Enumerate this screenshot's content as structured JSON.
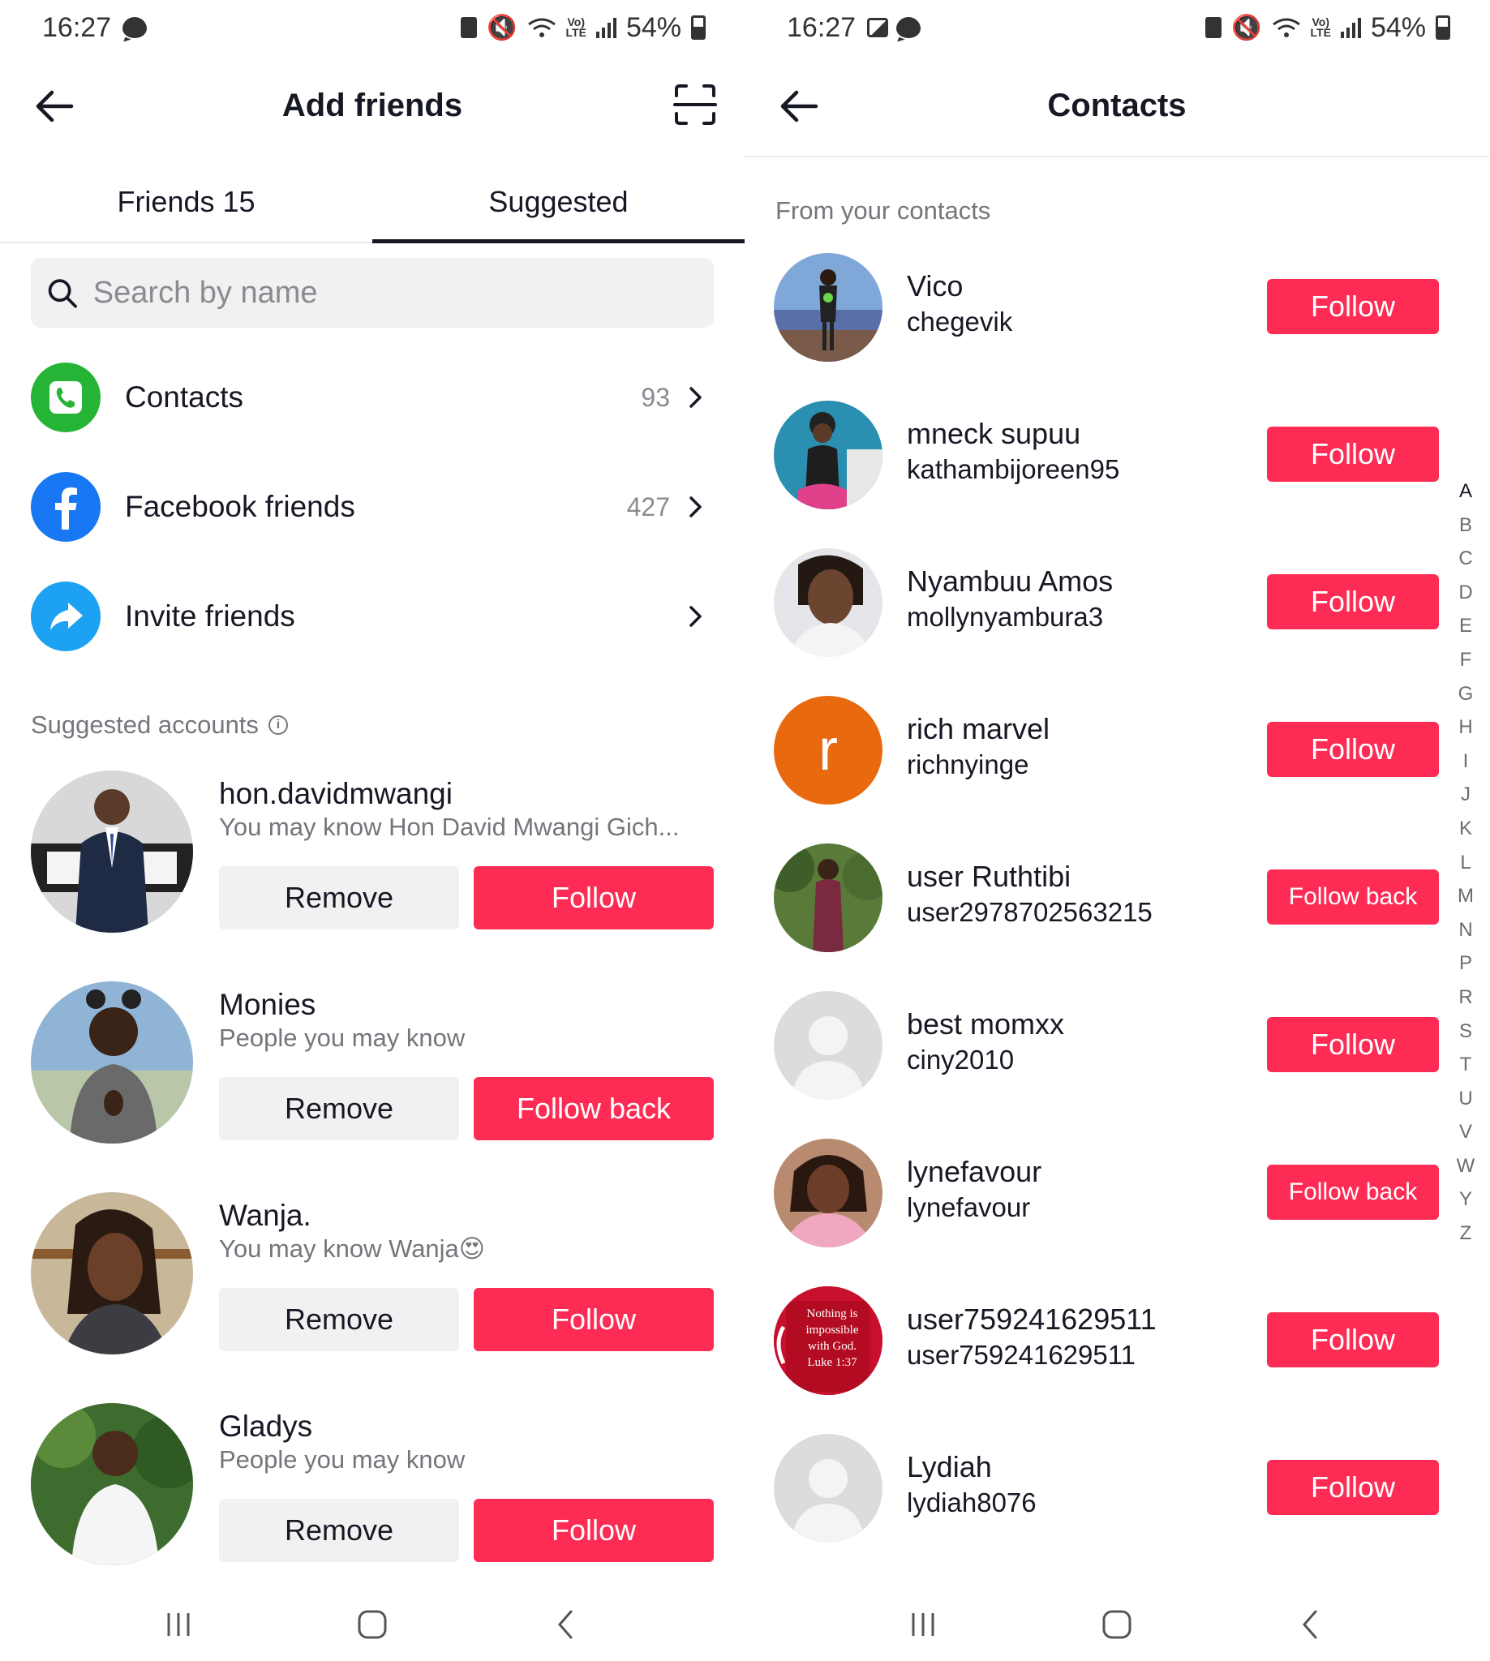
{
  "status_left": {
    "time": "16:27",
    "battery": "54%"
  },
  "status_right": {
    "time": "16:27",
    "battery": "54%"
  },
  "add_friends": {
    "title": "Add friends",
    "tabs": [
      {
        "label": "Friends 15",
        "active": false
      },
      {
        "label": "Suggested",
        "active": true
      }
    ],
    "search_placeholder": "Search by name",
    "menu": [
      {
        "label": "Contacts",
        "count": "93",
        "icon": "contacts-phone-icon",
        "color": "#25b436"
      },
      {
        "label": "Facebook friends",
        "count": "427",
        "icon": "facebook-icon",
        "color": "#1877f2"
      },
      {
        "label": "Invite friends",
        "count": "",
        "icon": "share-arrow-icon",
        "color": "#1da1f2"
      }
    ],
    "section_label": "Suggested accounts",
    "suggested": [
      {
        "name": "hon.davidmwangi",
        "sub": "You may know Hon David Mwangi Gich...",
        "remove": "Remove",
        "action": "Follow"
      },
      {
        "name": "Monies",
        "sub": "People you may know",
        "remove": "Remove",
        "action": "Follow back"
      },
      {
        "name": "Wanja.",
        "sub": "You may know Wanja😍",
        "remove": "Remove",
        "action": "Follow"
      },
      {
        "name": "Gladys",
        "sub": "People you may know",
        "remove": "Remove",
        "action": "Follow"
      }
    ]
  },
  "contacts": {
    "title": "Contacts",
    "section_label": "From your contacts",
    "list": [
      {
        "name": "Vico",
        "username": "chegevik",
        "action": "Follow"
      },
      {
        "name": "mneck supuu",
        "username": "kathambijoreen95",
        "action": "Follow"
      },
      {
        "name": "Nyambuu Amos",
        "username": "mollynyambura3",
        "action": "Follow"
      },
      {
        "name": "rich marvel",
        "username": "richnyinge",
        "action": "Follow",
        "avatar_letter": "r"
      },
      {
        "name": "user Ruthtibi",
        "username": "user2978702563215",
        "action": "Follow back"
      },
      {
        "name": "best momxx",
        "username": "ciny2010",
        "action": "Follow"
      },
      {
        "name": "lynefavour",
        "username": "lynefavour",
        "action": "Follow back"
      },
      {
        "name": "user759241629511",
        "username": "user759241629511",
        "action": "Follow",
        "avatar_text": [
          "Nothing is",
          "impossible",
          "with God.",
          "Luke 1:37"
        ]
      },
      {
        "name": "Lydiah",
        "username": "lydiah8076",
        "action": "Follow"
      }
    ],
    "alphabet": [
      "A",
      "B",
      "C",
      "D",
      "E",
      "F",
      "G",
      "H",
      "I",
      "J",
      "K",
      "L",
      "M",
      "N",
      "P",
      "R",
      "S",
      "T",
      "U",
      "V",
      "W",
      "Y",
      "Z"
    ]
  },
  "colors": {
    "accent": "#fe2c55",
    "text": "#161823",
    "secondary": "#75767c"
  }
}
